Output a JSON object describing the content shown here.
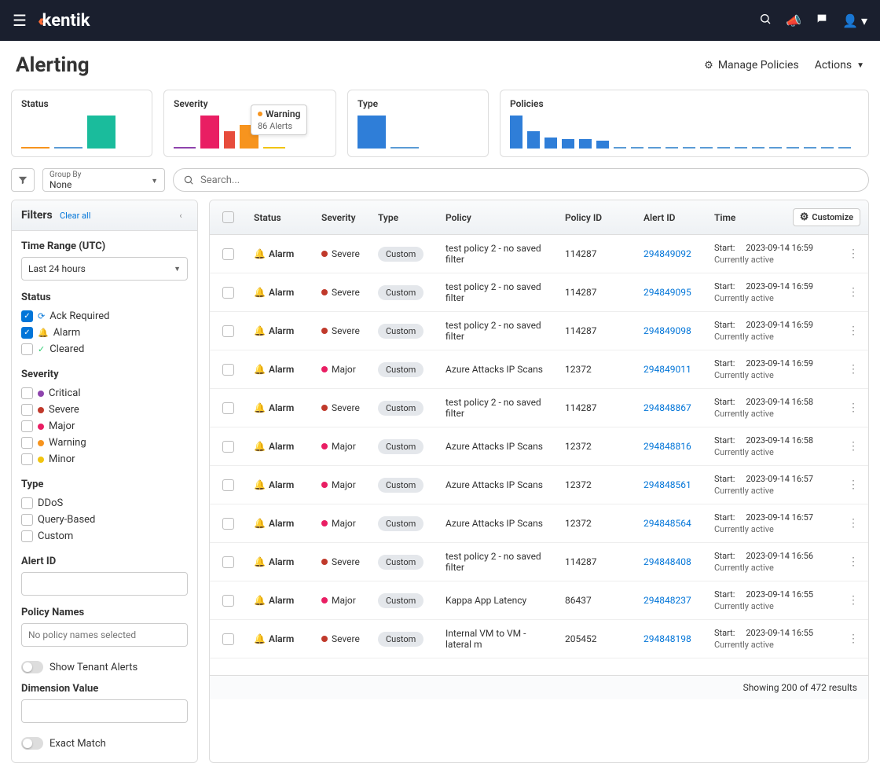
{
  "brand": "kentik",
  "page_title": "Alerting",
  "actions": {
    "manage": "Manage Policies",
    "actions": "Actions"
  },
  "summary": {
    "status": "Status",
    "severity": "Severity",
    "type": "Type",
    "policies": "Policies",
    "tooltip_title": "Warning",
    "tooltip_sub": "86 Alerts"
  },
  "groupby": {
    "label": "Group By",
    "value": "None"
  },
  "search_placeholder": "Search...",
  "filters": {
    "title": "Filters",
    "clear": "Clear all",
    "time_range": "Time Range (UTC)",
    "time_value": "Last 24 hours",
    "status_label": "Status",
    "status_items": [
      {
        "label": "Ack Required",
        "checked": true,
        "icon": "⟳",
        "color": "#0275d8"
      },
      {
        "label": "Alarm",
        "checked": true,
        "icon": "🔔",
        "color": "#f7941e"
      },
      {
        "label": "Cleared",
        "checked": false,
        "icon": "✓",
        "color": "#2ecc71"
      }
    ],
    "severity_label": "Severity",
    "severities": [
      {
        "label": "Critical",
        "color": "#8e44ad"
      },
      {
        "label": "Severe",
        "color": "#c0392b"
      },
      {
        "label": "Major",
        "color": "#e91e63"
      },
      {
        "label": "Warning",
        "color": "#f7941e"
      },
      {
        "label": "Minor",
        "color": "#f1c40f"
      }
    ],
    "type_label": "Type",
    "types": [
      "DDoS",
      "Query-Based",
      "Custom"
    ],
    "alert_id_label": "Alert ID",
    "policy_names_label": "Policy Names",
    "policy_names_placeholder": "No policy names selected",
    "tenant": "Show Tenant Alerts",
    "dimension": "Dimension Value",
    "exact": "Exact Match"
  },
  "columns": {
    "status": "Status",
    "severity": "Severity",
    "type": "Type",
    "policy": "Policy",
    "policy_id": "Policy ID",
    "alert_id": "Alert ID",
    "time": "Time",
    "customize": "Customize"
  },
  "time_start_label": "Start:",
  "time_active": "Currently active",
  "footer": "Showing 200 of 472 results",
  "sev_colors": {
    "Severe": "#c0392b",
    "Major": "#e91e63"
  },
  "rows": [
    {
      "status": "Alarm",
      "severity": "Severe",
      "type": "Custom",
      "policy": "test policy 2 - no saved filter",
      "policy_id": "114287",
      "alert_id": "294849092",
      "time": "2023-09-14 16:59"
    },
    {
      "status": "Alarm",
      "severity": "Severe",
      "type": "Custom",
      "policy": "test policy 2 - no saved filter",
      "policy_id": "114287",
      "alert_id": "294849095",
      "time": "2023-09-14 16:59"
    },
    {
      "status": "Alarm",
      "severity": "Severe",
      "type": "Custom",
      "policy": "test policy 2 - no saved filter",
      "policy_id": "114287",
      "alert_id": "294849098",
      "time": "2023-09-14 16:59"
    },
    {
      "status": "Alarm",
      "severity": "Major",
      "type": "Custom",
      "policy": "Azure Attacks IP Scans",
      "policy_id": "12372",
      "alert_id": "294849011",
      "time": "2023-09-14 16:59"
    },
    {
      "status": "Alarm",
      "severity": "Severe",
      "type": "Custom",
      "policy": "test policy 2 - no saved filter",
      "policy_id": "114287",
      "alert_id": "294848867",
      "time": "2023-09-14 16:58"
    },
    {
      "status": "Alarm",
      "severity": "Major",
      "type": "Custom",
      "policy": "Azure Attacks IP Scans",
      "policy_id": "12372",
      "alert_id": "294848816",
      "time": "2023-09-14 16:58"
    },
    {
      "status": "Alarm",
      "severity": "Major",
      "type": "Custom",
      "policy": "Azure Attacks IP Scans",
      "policy_id": "12372",
      "alert_id": "294848561",
      "time": "2023-09-14 16:57"
    },
    {
      "status": "Alarm",
      "severity": "Major",
      "type": "Custom",
      "policy": "Azure Attacks IP Scans",
      "policy_id": "12372",
      "alert_id": "294848564",
      "time": "2023-09-14 16:57"
    },
    {
      "status": "Alarm",
      "severity": "Severe",
      "type": "Custom",
      "policy": "test policy 2 - no saved filter",
      "policy_id": "114287",
      "alert_id": "294848408",
      "time": "2023-09-14 16:56"
    },
    {
      "status": "Alarm",
      "severity": "Major",
      "type": "Custom",
      "policy": "Kappa App Latency",
      "policy_id": "86437",
      "alert_id": "294848237",
      "time": "2023-09-14 16:55"
    },
    {
      "status": "Alarm",
      "severity": "Severe",
      "type": "Custom",
      "policy": "Internal VM to VM - lateral m",
      "policy_id": "205452",
      "alert_id": "294848198",
      "time": "2023-09-14 16:55"
    }
  ]
}
